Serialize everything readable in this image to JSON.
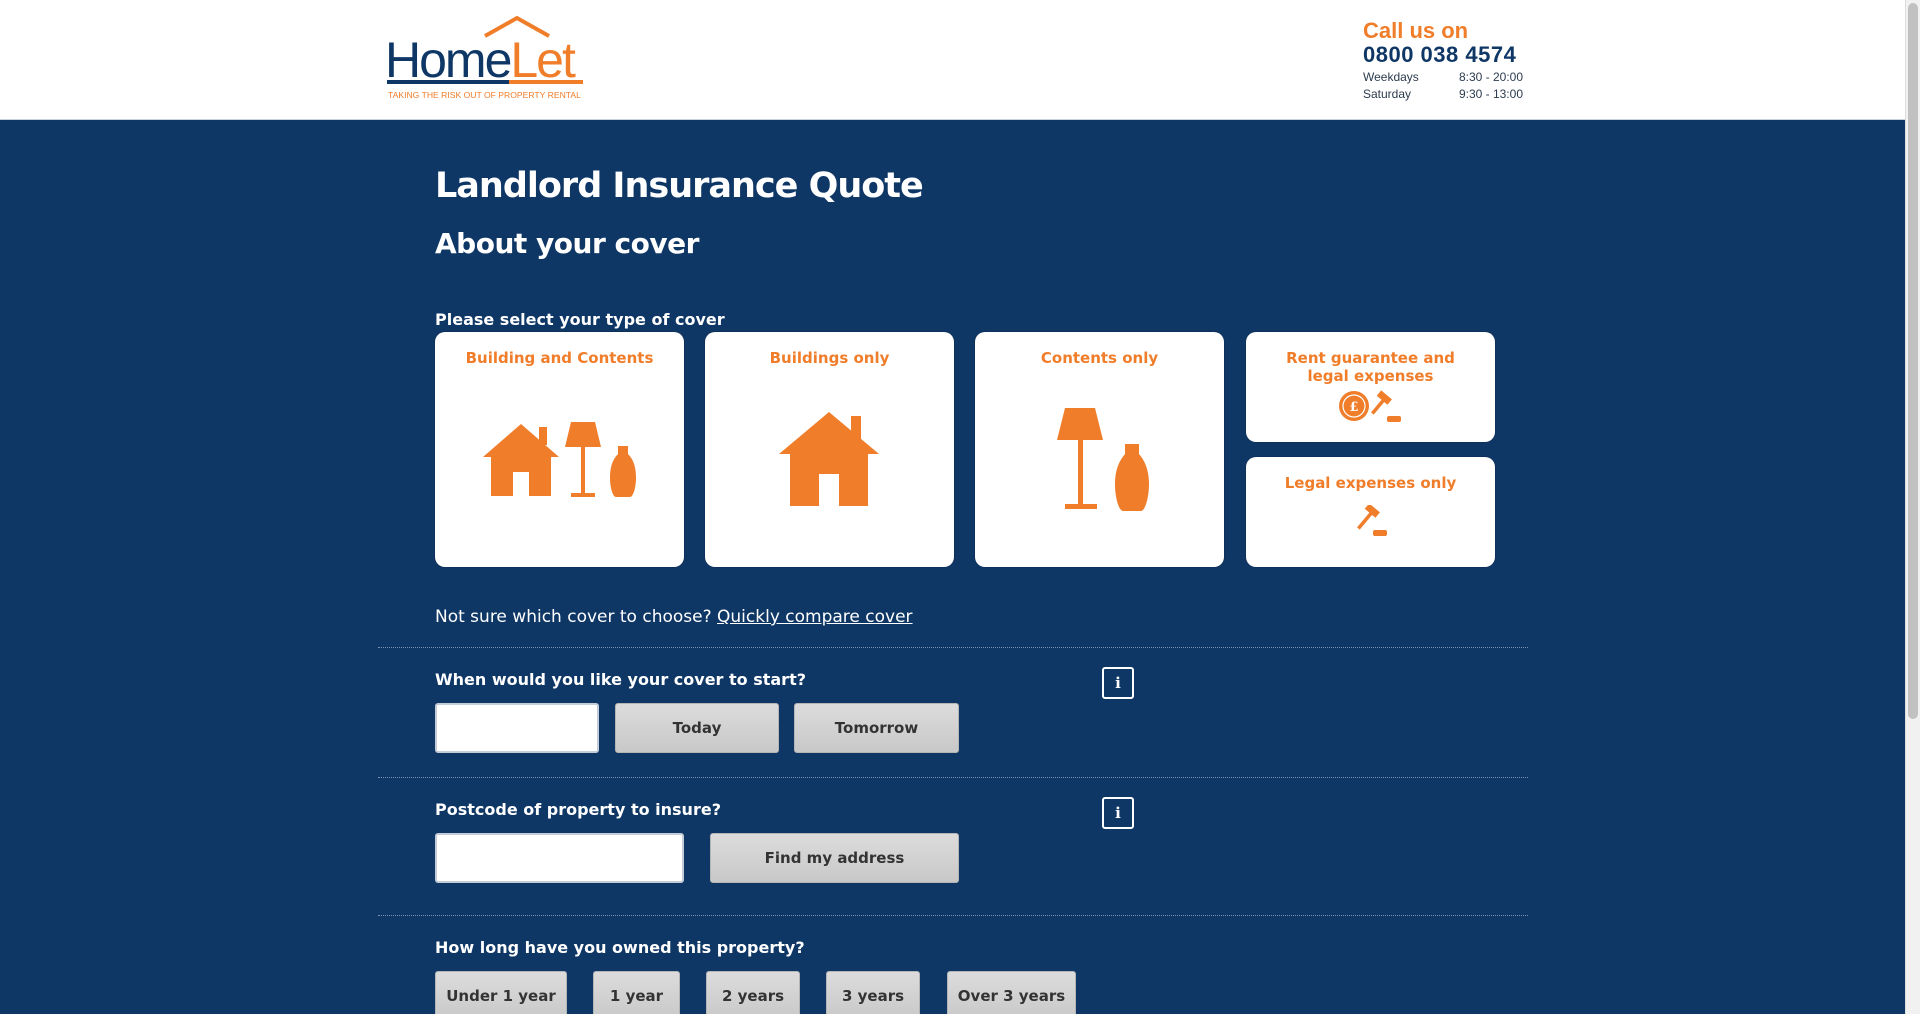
{
  "header": {
    "logo": {
      "home": "Home",
      "let": "Let",
      "tagline": "TAKING THE RISK OUT OF PROPERTY RENTAL"
    },
    "contact": {
      "title": "Call us on",
      "phone": "0800 038 4574",
      "hours": [
        {
          "day": "Weekdays",
          "time": "8:30 - 20:00"
        },
        {
          "day": "Saturday",
          "time": "9:30 - 13:00"
        }
      ]
    }
  },
  "page": {
    "title": "Landlord Insurance Quote",
    "subtitle": "About your cover"
  },
  "cover": {
    "label": "Please select your type of cover",
    "options": [
      {
        "label": "Building and Contents",
        "icon": "house-lamp-vase-icon"
      },
      {
        "label": "Buildings only",
        "icon": "house-icon"
      },
      {
        "label": "Contents only",
        "icon": "lamp-vase-icon"
      },
      {
        "label": "Rent guarantee and legal expenses",
        "icon": "pound-coin-gavel-icon"
      },
      {
        "label": "Legal expenses only",
        "icon": "gavel-icon"
      }
    ],
    "hint_text": "Not sure which cover to choose?",
    "hint_link": "Quickly compare cover"
  },
  "start": {
    "label": "When would you like your cover to start?",
    "date_value": "",
    "today": "Today",
    "tomorrow": "Tomorrow",
    "info": "i"
  },
  "postcode": {
    "label": "Postcode of property to insure?",
    "value": "",
    "find": "Find my address",
    "info": "i"
  },
  "ownership": {
    "label": "How long have you owned this property?",
    "options": [
      "Under 1 year",
      "1 year",
      "2 years",
      "3 years",
      "Over 3 years"
    ]
  },
  "colors": {
    "brand_navy": "#0f3766",
    "brand_orange": "#f07d2a"
  }
}
